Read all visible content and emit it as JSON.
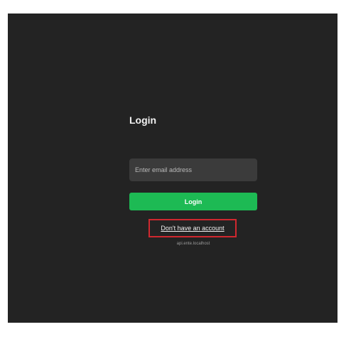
{
  "login": {
    "title": "Login",
    "email_placeholder": "Enter email address",
    "email_value": "",
    "button_label": "Login",
    "signup_link": "Don't have an account",
    "api_host": "api.ente.localhost"
  },
  "colors": {
    "background": "#232323",
    "input_background": "#3b3b3b",
    "accent": "#1dba54",
    "highlight_border": "#d0282f"
  }
}
